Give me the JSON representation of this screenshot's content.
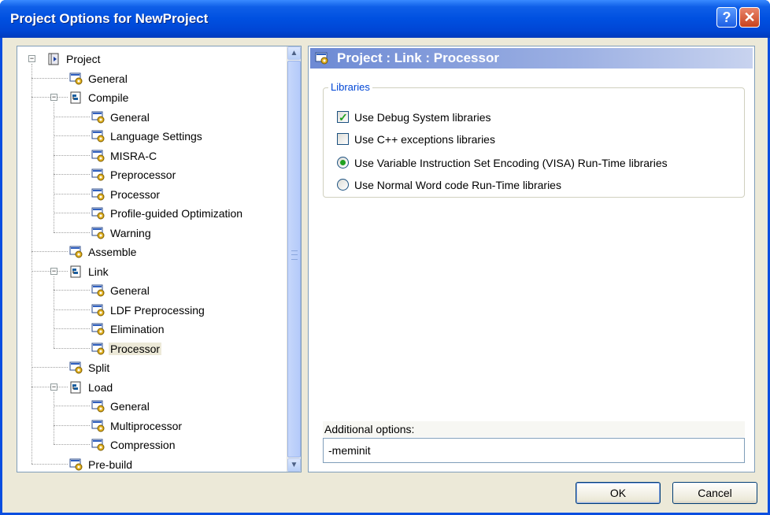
{
  "window": {
    "title": "Project Options for NewProject",
    "help_button": "?",
    "close_button": "✕"
  },
  "tree": {
    "items": [
      {
        "label": "Project",
        "icon": "project-icon",
        "level": 0,
        "expander": "−"
      },
      {
        "label": "General",
        "icon": "settings-page-icon",
        "level": 1
      },
      {
        "label": "Compile",
        "icon": "folder-node-icon",
        "level": 1,
        "expander": "−"
      },
      {
        "label": "General",
        "icon": "settings-page-icon",
        "level": 2
      },
      {
        "label": "Language Settings",
        "icon": "settings-page-icon",
        "level": 2
      },
      {
        "label": "MISRA-C",
        "icon": "settings-page-icon",
        "level": 2
      },
      {
        "label": "Preprocessor",
        "icon": "settings-page-icon",
        "level": 2
      },
      {
        "label": "Processor",
        "icon": "settings-page-icon",
        "level": 2
      },
      {
        "label": "Profile-guided Optimization",
        "icon": "settings-page-icon",
        "level": 2
      },
      {
        "label": "Warning",
        "icon": "settings-page-icon",
        "level": 2
      },
      {
        "label": "Assemble",
        "icon": "settings-page-icon",
        "level": 1
      },
      {
        "label": "Link",
        "icon": "folder-node-icon",
        "level": 1,
        "expander": "−"
      },
      {
        "label": "General",
        "icon": "settings-page-icon",
        "level": 2
      },
      {
        "label": "LDF Preprocessing",
        "icon": "settings-page-icon",
        "level": 2
      },
      {
        "label": "Elimination",
        "icon": "settings-page-icon",
        "level": 2
      },
      {
        "label": "Processor",
        "icon": "settings-page-icon",
        "level": 2,
        "selected": true
      },
      {
        "label": "Split",
        "icon": "settings-page-icon",
        "level": 1
      },
      {
        "label": "Load",
        "icon": "folder-node-icon",
        "level": 1,
        "expander": "−"
      },
      {
        "label": "General",
        "icon": "settings-page-icon",
        "level": 2
      },
      {
        "label": "Multiprocessor",
        "icon": "settings-page-icon",
        "level": 2
      },
      {
        "label": "Compression",
        "icon": "settings-page-icon",
        "level": 2
      },
      {
        "label": "Pre-build",
        "icon": "settings-page-icon",
        "level": 1
      }
    ]
  },
  "panel": {
    "header": "Project : Link : Processor",
    "group_title": "Libraries",
    "options": [
      {
        "type": "checkbox",
        "label": "Use Debug System libraries",
        "checked": true
      },
      {
        "type": "checkbox",
        "label": "Use C++ exceptions libraries",
        "checked": false
      },
      {
        "type": "radio",
        "label": "Use Variable Instruction Set Encoding (VISA) Run-Time libraries",
        "checked": true
      },
      {
        "type": "radio",
        "label": "Use Normal Word code Run-Time libraries",
        "checked": false
      }
    ],
    "additional_label": "Additional options:",
    "additional_value": "-meminit"
  },
  "buttons": {
    "ok": "OK",
    "cancel": "Cancel"
  },
  "colors": {
    "titlebar": "#0050e0",
    "dialog_bg": "#ece9d8",
    "accent_green": "#21a121",
    "group_title": "#0046d5"
  }
}
